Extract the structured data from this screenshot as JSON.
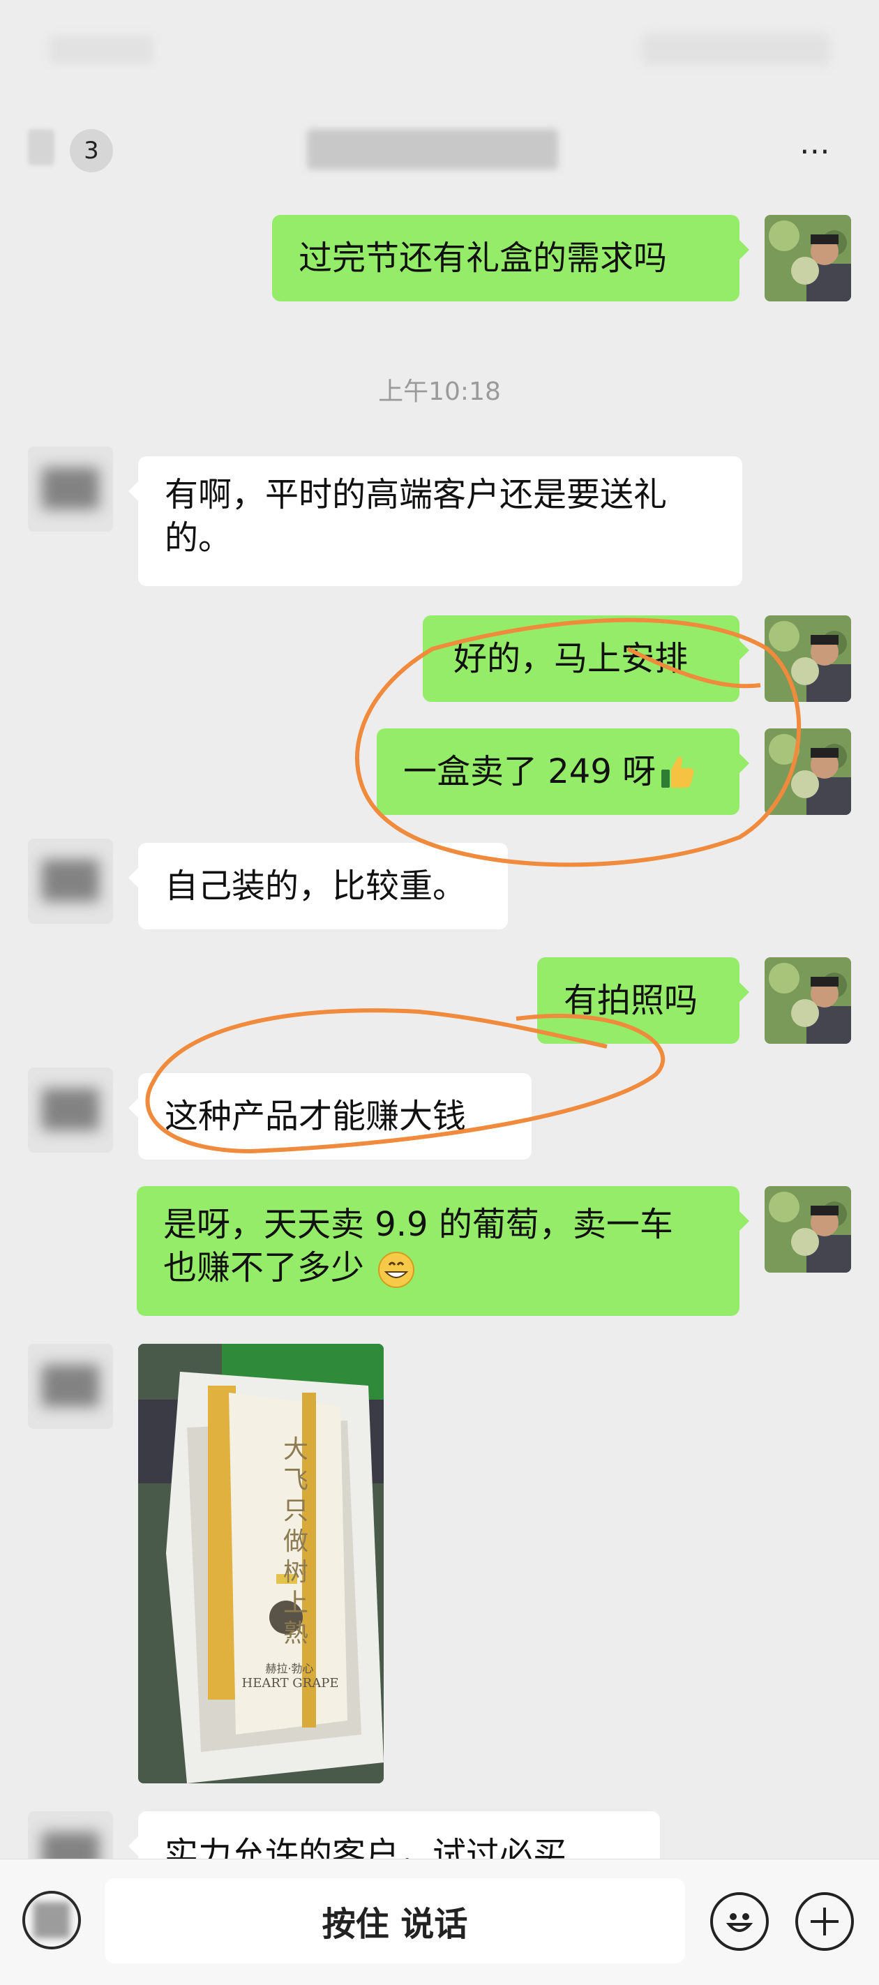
{
  "header": {
    "unread_count": "3",
    "more_icon": "⋯"
  },
  "messages": {
    "m1": "过完节还有礼盒的需求吗",
    "timestamp": "上午10:18",
    "m2_line1": "有啊，平时的高端客户还是要送礼",
    "m2_line2": "的。",
    "m3": "好的，马上安排",
    "m4_text": "一盒卖了 249 呀",
    "m4_emoji": "thumbs-up-emoji",
    "m5": "自己装的，比较重。",
    "m6": "有拍照吗",
    "m7": "这种产品才能赚大钱",
    "m8_line1": "是呀，天天卖 9.9 的葡萄，卖一车",
    "m8_line2": "也赚不了多少",
    "m8_emoji": "grinning-emoji",
    "m10": "实力允许的客户，试过必买"
  },
  "photo": {
    "box_title": "大飞只做树上熟",
    "brand_cn": "赫拉·勃心",
    "brand_en": "HEART GRAPE"
  },
  "input_bar": {
    "hold_to_talk": "按住 说话"
  },
  "colors": {
    "background": "#ededed",
    "my_bubble": "#95ec69",
    "other_bubble": "#ffffff",
    "annotation": "#f08a3c"
  }
}
